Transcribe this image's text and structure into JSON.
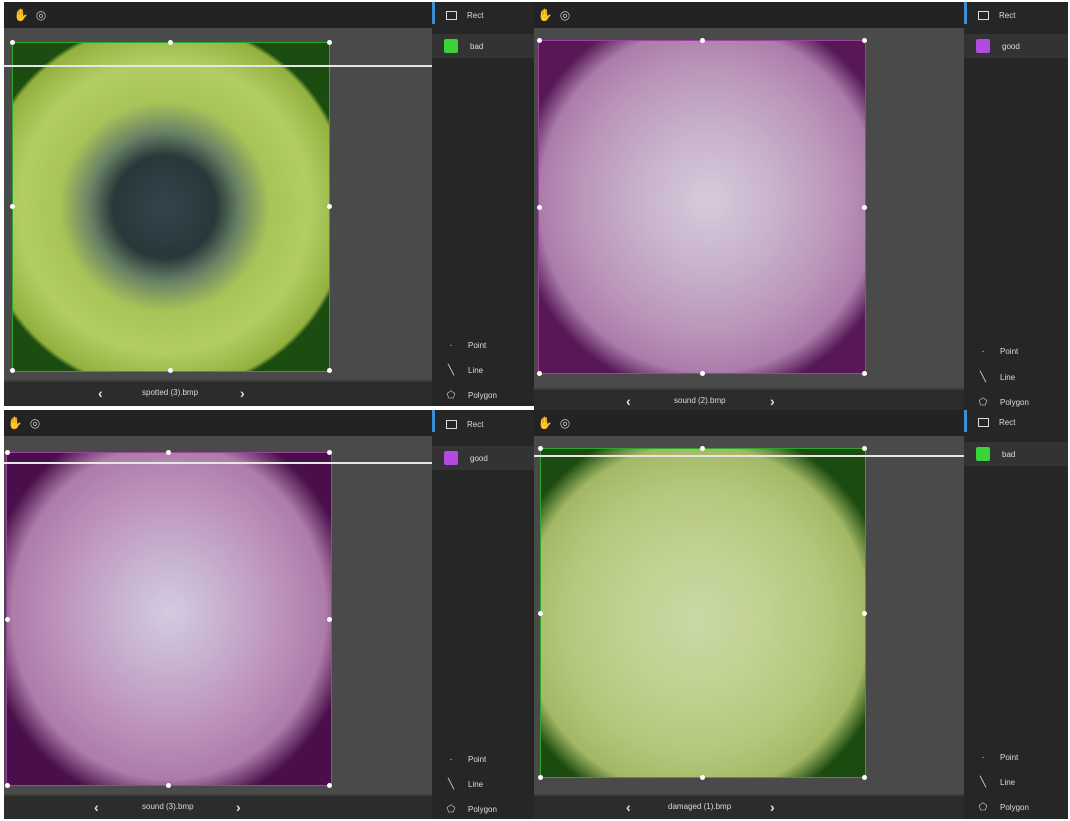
{
  "colors": {
    "bad": "#3ad43a",
    "good": "#b44be0",
    "bad_tint": "#1a5a10",
    "good_tint": "#4a0f4a"
  },
  "toolbar": {
    "hand_icon": "hand-icon",
    "target_icon": "target-icon"
  },
  "panels": [
    {
      "id": "p1",
      "filename": "spotted (3).bmp",
      "label": "bad",
      "shape": "Rect",
      "tools": [
        "Point",
        "Line",
        "Polygon"
      ]
    },
    {
      "id": "p2",
      "filename": "sound (2).bmp",
      "label": "good",
      "shape": "Rect",
      "tools": [
        "Point",
        "Line",
        "Polygon"
      ]
    },
    {
      "id": "p3",
      "filename": "sound (3).bmp",
      "label": "good",
      "shape": "Rect",
      "tools": [
        "Point",
        "Line",
        "Polygon"
      ]
    },
    {
      "id": "p4",
      "filename": "damaged (1).bmp",
      "label": "bad",
      "shape": "Rect",
      "tools": [
        "Point",
        "Line",
        "Polygon"
      ]
    }
  ],
  "nav": {
    "prev": "‹",
    "next": "›"
  }
}
